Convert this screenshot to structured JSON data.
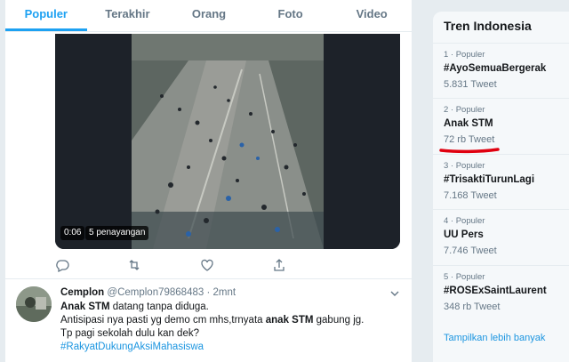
{
  "tabs": [
    {
      "label": "Populer"
    },
    {
      "label": "Terakhir"
    },
    {
      "label": "Orang"
    },
    {
      "label": "Foto"
    },
    {
      "label": "Video"
    }
  ],
  "video": {
    "duration": "0:06",
    "views": "5 penayangan"
  },
  "tweet": {
    "name": "Cemplon",
    "handle": "@Cemplon79868483",
    "time": "· 2mnt",
    "line1_bold": "Anak STM",
    "line1_rest": " datang tanpa diduga.",
    "line2_pre": "Antisipasi nya pasti yg demo cm mhs,trnyata ",
    "line2_bold": "anak STM",
    "line2_post": " gabung jg.",
    "line3": "Tp pagi sekolah dulu kan dek?",
    "hashtag": "#RakyatDukungAksiMahasiswa"
  },
  "trends": {
    "title": "Tren Indonesia",
    "items": [
      {
        "meta": "1 · Populer",
        "name": "#AyoSemuaBergerak",
        "count": "5.831 Tweet"
      },
      {
        "meta": "2 · Populer",
        "name": "Anak STM",
        "count": "72 rb Tweet"
      },
      {
        "meta": "3 · Populer",
        "name": "#TrisaktiTurunLagi",
        "count": "7.168 Tweet"
      },
      {
        "meta": "4 · Populer",
        "name": "UU Pers",
        "count": "7.746 Tweet"
      },
      {
        "meta": "5 · Populer",
        "name": "#ROSExSaintLaurent",
        "count": "348 rb Tweet"
      }
    ],
    "show_more": "Tampilkan lebih banyak"
  },
  "colors": {
    "accent": "#1da1f2",
    "annotation": "#e0000f"
  }
}
